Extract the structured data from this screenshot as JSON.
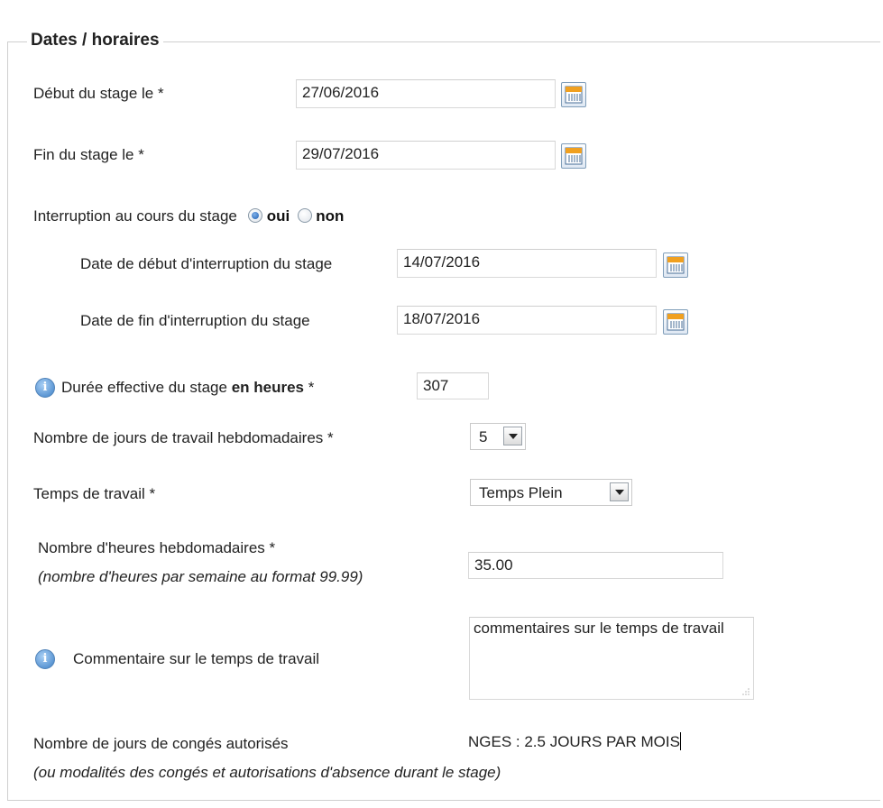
{
  "section": {
    "legend": "Dates / horaires"
  },
  "debut_stage": {
    "label": "Début du stage le *",
    "value": "27/06/2016"
  },
  "fin_stage": {
    "label": "Fin du stage le *",
    "value": "29/07/2016"
  },
  "interruption": {
    "label": "Interruption au cours du stage",
    "option_oui": "oui",
    "option_non": "non",
    "selected": "oui",
    "debut_label": "Date de début d'interruption du stage",
    "debut_value": "14/07/2016",
    "fin_label": "Date de fin d'interruption du stage",
    "fin_value": "18/07/2016"
  },
  "duree": {
    "label_prefix": "Durée effective du stage ",
    "label_bold": "en heures",
    "label_suffix": " *",
    "value": "307"
  },
  "jours_hebdo": {
    "label": "Nombre de jours de travail hebdomadaires *",
    "selected": "5"
  },
  "temps_travail": {
    "label": "Temps de travail *",
    "selected": "Temps Plein"
  },
  "heures_hebdo": {
    "label": "Nombre d'heures hebdomadaires *",
    "note": "(nombre d'heures par semaine au format 99.99)",
    "value": "35.00"
  },
  "commentaire": {
    "label": "Commentaire sur le temps de travail",
    "value": "commentaires sur le temps de travail"
  },
  "conges": {
    "label": "Nombre de jours de congés autorisés",
    "note": "(ou modalités des congés et autorisations d'absence durant le stage)",
    "value": "NGES : 2.5 JOURS PAR MOIS"
  },
  "icons": {
    "calendar": "calendar-icon",
    "info": "info-icon",
    "dropdown": "chevron-down-icon",
    "resize": "resize-grip-icon"
  },
  "colors": {
    "fieldset_border": "#cfcfcf",
    "calendar_accent": "#f0a020",
    "info_blue": "#3d7fc6"
  }
}
